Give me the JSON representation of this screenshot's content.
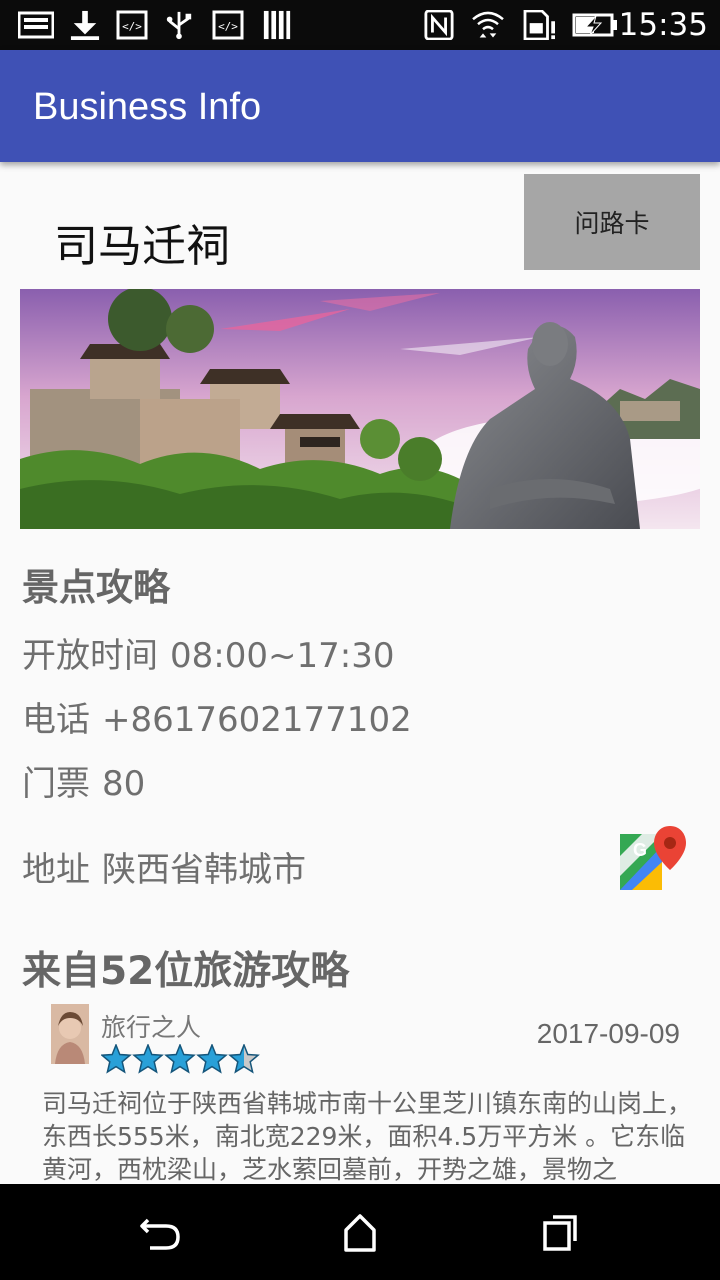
{
  "status_bar": {
    "time": "15:35",
    "icons": [
      "screenshot-icon",
      "download-icon",
      "code-icon",
      "usb-icon",
      "code-icon",
      "storage-icon",
      "nfc-icon",
      "wifi-icon",
      "sim-alert-icon",
      "battery-charging-icon"
    ]
  },
  "app_bar": {
    "title": "Business Info"
  },
  "place": {
    "name": "司马迁祠",
    "route_button": "问路卡"
  },
  "guide": {
    "title": "景点攻略",
    "hours_label": "开放时间",
    "hours_value": "08:00~17:30",
    "phone_label": "电话",
    "phone_value": "+8617602177102",
    "ticket_label": "门票",
    "ticket_value": "80",
    "address_label": "地址",
    "address_value": "陕西省韩城市"
  },
  "reviews": {
    "title": "来自52位旅游攻略",
    "items": [
      {
        "author": "旅行之人",
        "rating": 4.5,
        "date": "2017-09-09",
        "text": "司马迁祠位于陕西省韩城市南十公里芝川镇东南的山岗上，东西长555米，南北宽229米，面积4.5万平方米 。它东临黄河，西枕梁山，芝水萦回墓前，开势之雄，景物之"
      }
    ]
  },
  "nav_bar": {
    "buttons": [
      "back-icon",
      "home-icon",
      "recents-icon"
    ]
  },
  "colors": {
    "app_bar": "#3f51b5",
    "route_button": "#a6a6a6",
    "star": "#29a0d8"
  }
}
